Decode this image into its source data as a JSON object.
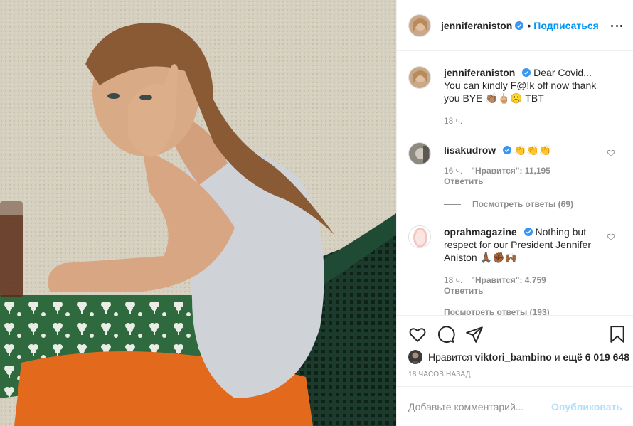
{
  "post": {
    "author": "jenniferaniston",
    "follow_label": "Подписаться",
    "dot": "•",
    "accent": "#0095f6",
    "verified_color": "#3897f0"
  },
  "caption": {
    "user": "jenniferaniston",
    "text": "Dear Covid... You can kindly F@!k off now thank you BYE 👏🏽🖕🏼☹️ TBT",
    "time": "18 ч."
  },
  "comments": [
    {
      "user": "lisakudrow",
      "text": "👏👏👏",
      "time": "16 ч.",
      "likes": "\"Нравится\": 11,195",
      "reply": "Ответить",
      "view_replies": "Посмотреть ответы (69)"
    },
    {
      "user": "oprahmagazine",
      "text": "Nothing but respect for our President Jennifer Aniston 🙏🏾✊🏾🙌🏾",
      "time": "18 ч.",
      "likes": "\"Нравится\": 4,759",
      "reply": "Ответить",
      "view_replies_cut": "Посмотреть ответы (193)"
    }
  ],
  "likes_line": {
    "prefix": "Нравится",
    "user": "viktori_bambino",
    "middle": "и",
    "rest": "ещё 6 019 648"
  },
  "time_ago": "18 ЧАСОВ НАЗАД",
  "add_comment": {
    "placeholder": "Добавьте комментарий...",
    "publish_label": "Опубликовать"
  },
  "icons": [
    "heart-icon",
    "comment-icon",
    "share-icon",
    "bookmark-icon",
    "more-icon",
    "verified-icon"
  ]
}
